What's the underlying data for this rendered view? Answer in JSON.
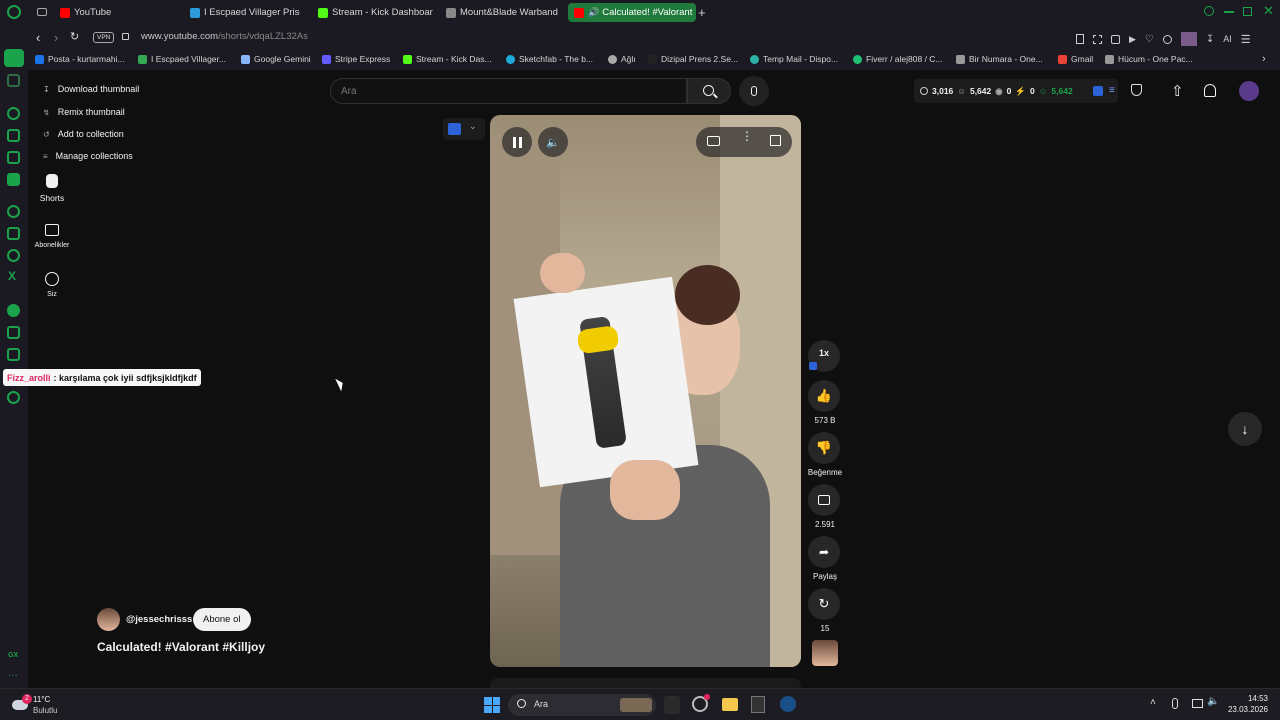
{
  "browser": {
    "tabs": [
      {
        "label": "YouTube",
        "color": "#ff0000"
      },
      {
        "label": "I Escpaed Villager Prison",
        "color": "#2d9cdb"
      },
      {
        "label": "Stream - Kick Dashboard",
        "color": "#53fc18"
      },
      {
        "label": "Mount&Blade Warband -",
        "color": "#888888"
      },
      {
        "label": "Calculated! #Valorant",
        "color": "#ff0000"
      }
    ],
    "url_host": "www.youtube.com",
    "url_path": "/shorts/vdqaLZL32As",
    "vpn_label": "VPN",
    "ai_label": "AI",
    "bookmarks": [
      {
        "label": "Posta - kurtarmahi...",
        "color": "#1a73e8"
      },
      {
        "label": "I Escpaed Villager...",
        "color": "#34a853"
      },
      {
        "label": "Google Gemini",
        "color": "#8ab4f8"
      },
      {
        "label": "Stripe Express",
        "color": "#635bff"
      },
      {
        "label": "Stream - Kick Das...",
        "color": "#53fc18"
      },
      {
        "label": "Sketchfab - The b...",
        "color": "#1caad9"
      },
      {
        "label": "Ağlı",
        "color": "#aaaaaa"
      },
      {
        "label": "Dizipal Prens 2.Se...",
        "color": "#222222"
      },
      {
        "label": "Temp Mail - Dispo...",
        "color": "#2bb3a8"
      },
      {
        "label": "Fiverr / alej808 / C...",
        "color": "#1dbf73"
      },
      {
        "label": "Bir Numara - One...",
        "color": "#999999"
      },
      {
        "label": "Gmail",
        "color": "#ea4335"
      },
      {
        "label": "Hücum - One Pac...",
        "color": "#999999"
      }
    ]
  },
  "context_menu": {
    "items": [
      "Download thumbnail",
      "Remix thumbnail",
      "Add to collection",
      "Manage collections"
    ]
  },
  "yt_nav": {
    "shorts": "Shorts",
    "subscriptions": "Abonelikler",
    "you": "Siz"
  },
  "search": {
    "placeholder": "Ara"
  },
  "stats": {
    "views": "3,016",
    "users": "5,642",
    "eye": "0",
    "bolt": "0",
    "users_green": "5,642"
  },
  "chat_overlay": {
    "user": "Fizz_arolli",
    "message": ": karşılama çok iyii sdfjksjkldfjkdf"
  },
  "player": {
    "speed": "1x",
    "likes": "573 B",
    "dislike_label": "Beğenme",
    "comments": "2.591",
    "share_label": "Paylaş",
    "remix_count": "15"
  },
  "short_info": {
    "channel": "@jessechrisss",
    "subscribe": "Abone ol",
    "title": "Calculated! #Valorant #Killjoy"
  },
  "taskbar": {
    "temp": "11°C",
    "weather": "Bulutlu",
    "search": "Ara",
    "time": "14:53",
    "date": "23.03.2026",
    "notif_count": "2"
  },
  "colors": {
    "accent_green": "#1aa34a",
    "yt_red": "#ff0000",
    "chat_name": "#e0245e"
  }
}
